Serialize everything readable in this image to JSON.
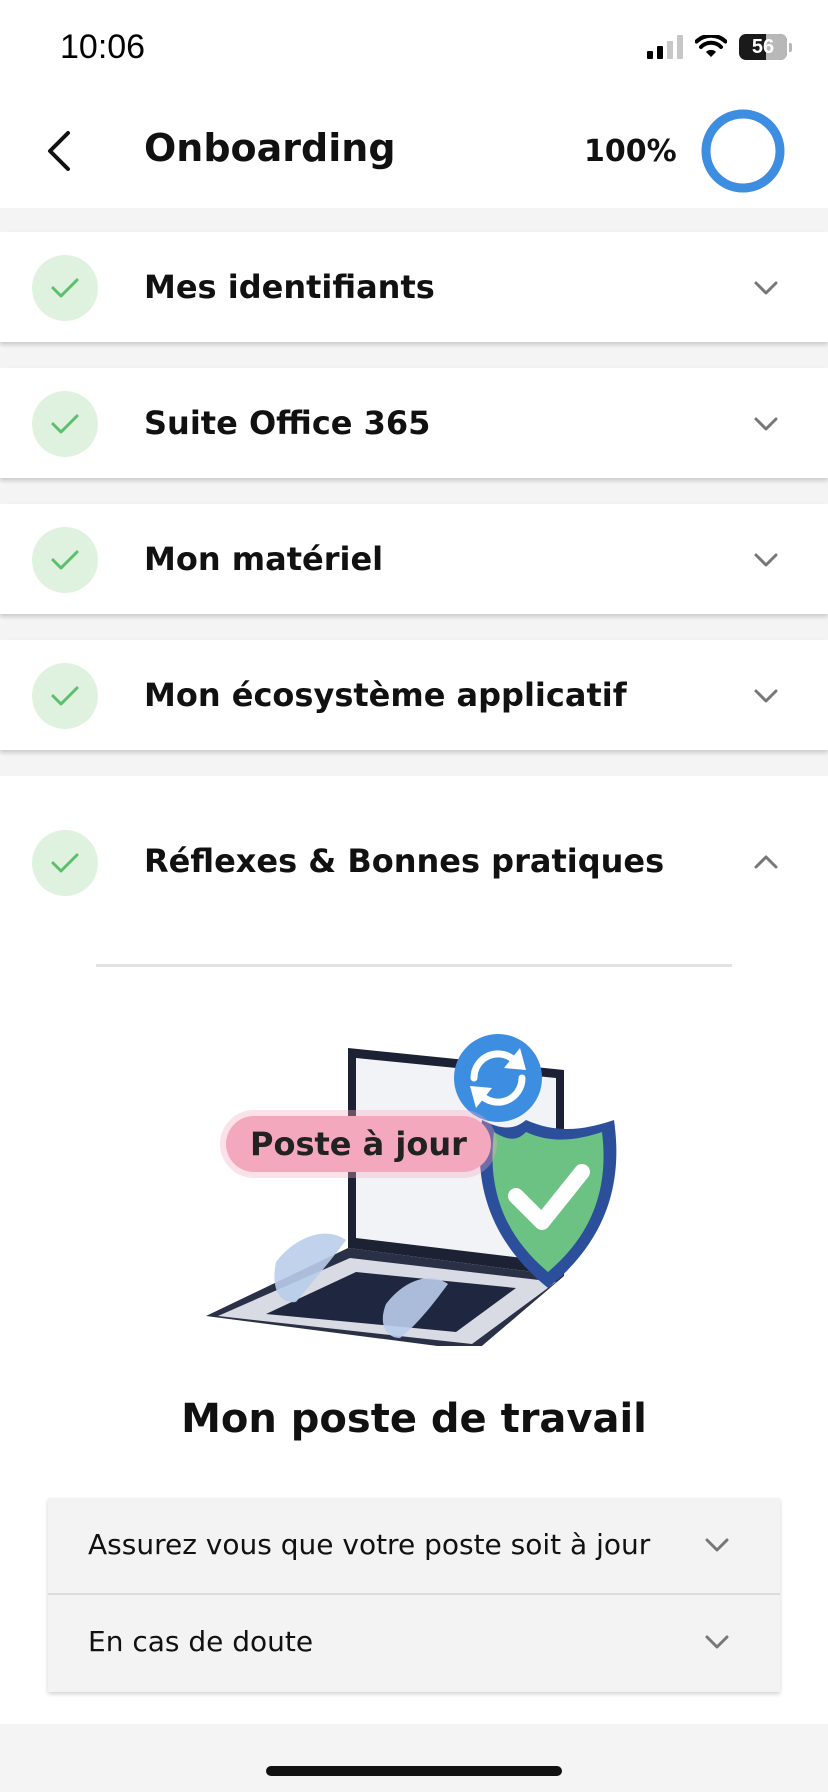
{
  "status_bar": {
    "time": "10:06",
    "battery_level": "56"
  },
  "header": {
    "title": "Onboarding",
    "progress_label": "100%",
    "progress_value": 1.0,
    "accent_color": "#3d8ee0"
  },
  "sections": [
    {
      "label": "Mes identifiants",
      "completed": true,
      "expanded": false
    },
    {
      "label": "Suite Office 365",
      "completed": true,
      "expanded": false
    },
    {
      "label": "Mon matériel",
      "completed": true,
      "expanded": false
    },
    {
      "label": "Mon écosystème applicatif",
      "completed": true,
      "expanded": false
    },
    {
      "label": "Réflexes & Bonnes pratiques",
      "completed": true,
      "expanded": true
    }
  ],
  "expanded_section": {
    "illustration_tag": "Poste à jour",
    "title": "Mon poste de travail",
    "items": [
      {
        "label": "Assurez vous que votre poste soit à jour"
      },
      {
        "label": "En cas de doute"
      }
    ]
  },
  "colors": {
    "check_green": "#5cbf6a",
    "check_badge_bg": "#dff2df",
    "shield_green": "#6cc283",
    "shield_border": "#2c4f9c",
    "tag_pink": "#f4a8bd"
  }
}
